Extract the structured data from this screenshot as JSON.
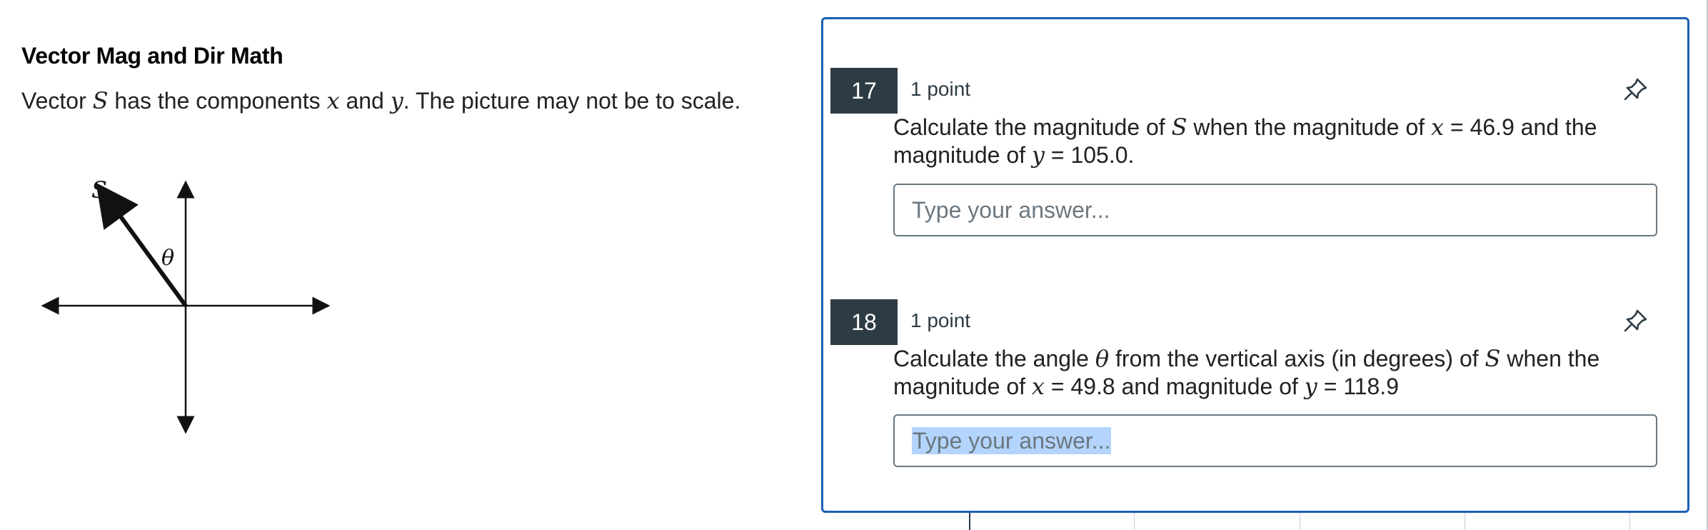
{
  "left": {
    "title": "Vector Mag and Dir Math",
    "prompt": {
      "text1": "Vector ",
      "var_S": "S",
      "text2": " has the components ",
      "var_x": "x",
      "text3": " and ",
      "var_y": "y",
      "text4": ".  The picture may not be to scale."
    },
    "diagram": {
      "label_vector": "S",
      "label_angle": "θ"
    }
  },
  "questions": [
    {
      "number": "17",
      "points": "1 point",
      "line1": {
        "pre": "Calculate the magnitude of ",
        "var": "S",
        "mid": " when the magnitude of ",
        "var2": "x",
        "eq": " = ",
        "val": "46.9 and the"
      },
      "line2": {
        "pre": "magnitude of ",
        "var": "y",
        "eq": " = ",
        "val": "105.0."
      },
      "input_placeholder": "Type your answer...",
      "pin_icon": "pin-icon"
    },
    {
      "number": "18",
      "points": "1 point",
      "line1": {
        "pre": "Calculate the angle ",
        "var": "θ",
        "mid": " from the vertical axis (in degrees) of ",
        "var2": "S",
        "post": " when the"
      },
      "line2": {
        "pre": "magnitude of ",
        "var": "x",
        "eq": " = ",
        "val": "49.8 and magnitude of ",
        "var2": "y",
        "eq2": " = ",
        "val2": "118.9"
      },
      "input_placeholder": "Type your answer...",
      "pin_icon": "pin-icon"
    }
  ],
  "colors": {
    "accent_border": "#1a5fb4",
    "number_badge": "#2d3b45",
    "selection": "#b3d4fc"
  }
}
